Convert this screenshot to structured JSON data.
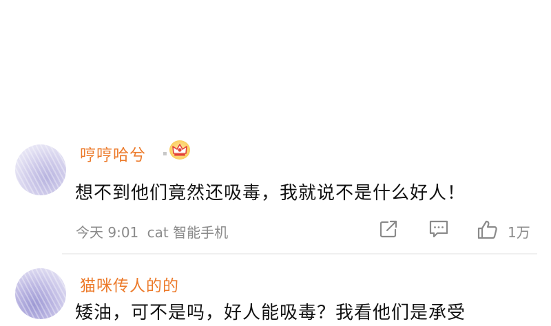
{
  "comments": [
    {
      "username": "哼哼哈兮",
      "text": "想不到他们竟然还吸毒，我就说不是什么好人！",
      "time": "今天 9:01",
      "source": "cat 智能手机",
      "likes": "1万",
      "badge_icon": "crown-icon"
    },
    {
      "username": "猫咪传人的的",
      "text": "矮油，可不是吗，好人能吸毒？我看他们是承受"
    }
  ],
  "colors": {
    "username": "#ec7a2a",
    "text": "#111111",
    "meta": "#8a8a8a",
    "badge": "#f6bd3d",
    "badge_accent": "#e2403a"
  },
  "icons": {
    "share": "share-icon",
    "reply": "comment-icon",
    "like": "thumbs-up-icon"
  }
}
